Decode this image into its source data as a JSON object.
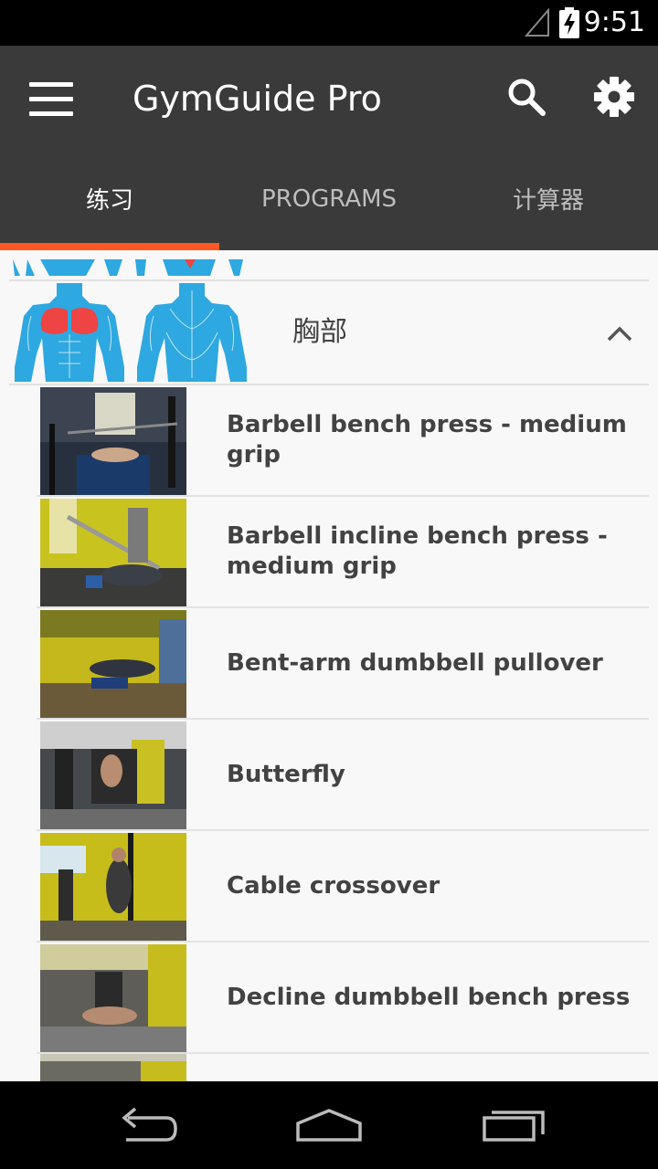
{
  "status_bar": {
    "time": "9:51"
  },
  "toolbar": {
    "title": "GymGuide Pro",
    "menu_icon": "hamburger-menu-icon",
    "search_icon": "search-icon",
    "settings_icon": "gear-icon"
  },
  "tabs": [
    {
      "label": "练习",
      "active": true
    },
    {
      "label": "PROGRAMS",
      "active": false
    },
    {
      "label": "计算器",
      "active": false
    }
  ],
  "colors": {
    "toolbar_bg": "#3a3a3a",
    "tab_indicator": "#ff5722",
    "muscle_highlight": "#ee4444",
    "muscle_body": "#2ea8e0"
  },
  "muscle_group": {
    "title": "胸部",
    "expanded": true,
    "collapse_icon": "chevron-up-icon"
  },
  "exercises": [
    {
      "name": "Barbell bench press - medium grip"
    },
    {
      "name": "Barbell incline bench press - medium grip"
    },
    {
      "name": "Bent-arm dumbbell pullover"
    },
    {
      "name": "Butterfly"
    },
    {
      "name": "Cable crossover"
    },
    {
      "name": "Decline dumbbell bench press"
    }
  ]
}
